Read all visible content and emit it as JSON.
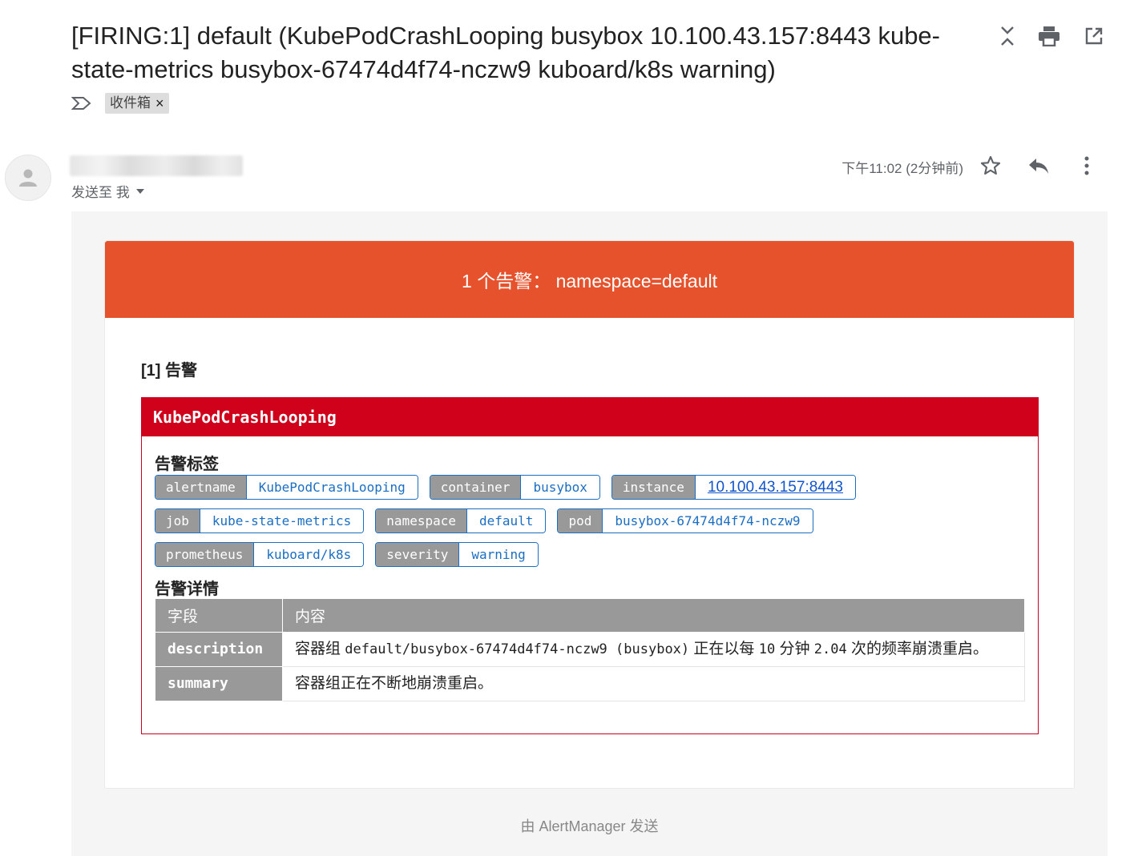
{
  "subject": "[FIRING:1] default (KubePodCrashLooping busybox 10.100.43.157:8443 kube-state-metrics busybox-67474d4f74-nczw9 kuboard/k8s warning)",
  "label_chip": "收件箱",
  "label_remove": "×",
  "to_me": "发送至 我",
  "time": "下午11:02 (2分钟前)",
  "banner_title": "1 个告警： namespace=default",
  "alert_number": "[1] 告警",
  "alert_name": "KubePodCrashLooping",
  "labels_title": "告警标签",
  "labels": [
    [
      {
        "key": "alertname",
        "value": "KubePodCrashLooping"
      },
      {
        "key": "container",
        "value": "busybox"
      },
      {
        "key": "instance",
        "value": "10.100.43.157:8443",
        "link": true
      }
    ],
    [
      {
        "key": "job",
        "value": "kube-state-metrics"
      },
      {
        "key": "namespace",
        "value": "default"
      },
      {
        "key": "pod",
        "value": "busybox-67474d4f74-nczw9"
      }
    ],
    [
      {
        "key": "prometheus",
        "value": "kuboard/k8s"
      },
      {
        "key": "severity",
        "value": "warning"
      }
    ]
  ],
  "details_title": "告警详情",
  "details_headers": [
    "字段",
    "内容"
  ],
  "details_rows": [
    {
      "field": "description",
      "parts": [
        "容器组 ",
        "default/busybox-67474d4f74-nczw9 (busybox)",
        " 正在以每 ",
        "10",
        " 分钟 ",
        "2.04",
        " 次的频率崩溃重启。"
      ]
    },
    {
      "field": "summary",
      "parts": [
        "容器组正在不断地崩溃重启。"
      ]
    }
  ],
  "footer": "由 AlertManager 发送",
  "colors": {
    "banner": "#e6522c",
    "alert_head": "#d0021b",
    "tag_key_bg": "#999999",
    "tag_value_text": "#1b6ec2"
  },
  "icons": {
    "top": [
      "collapse-icon",
      "print-icon",
      "open-new-window-icon"
    ],
    "meta": [
      "star-icon",
      "reply-icon",
      "more-vert-icon"
    ]
  }
}
